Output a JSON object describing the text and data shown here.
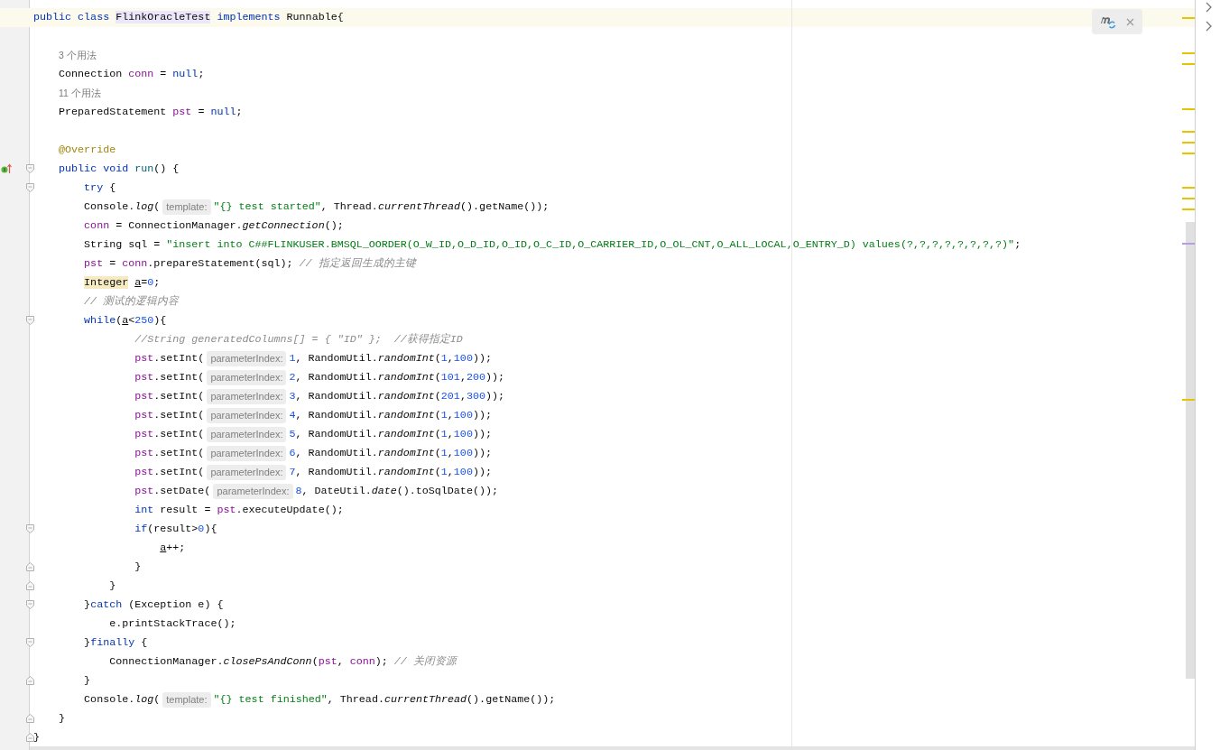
{
  "editor": {
    "lines": [
      {
        "kind": "code",
        "current": true,
        "tokens": [
          {
            "kind": "kw",
            "text": "public class "
          },
          {
            "kind": "decl",
            "text": "FlinkOracleTest"
          },
          {
            "kind": "kw",
            "text": " implements "
          },
          {
            "kind": "plain",
            "text": "Runnable{"
          }
        ]
      },
      {
        "kind": "blank",
        "current": false
      },
      {
        "kind": "usage",
        "current": false,
        "text": "    3 个用法"
      },
      {
        "kind": "code",
        "current": false,
        "tokens": [
          {
            "kind": "plain",
            "text": "    Connection "
          },
          {
            "kind": "field",
            "text": "conn"
          },
          {
            "kind": "plain",
            "text": " = "
          },
          {
            "kind": "kw",
            "text": "null"
          },
          {
            "kind": "plain",
            "text": ";"
          }
        ]
      },
      {
        "kind": "usage",
        "current": false,
        "text": "    11 个用法"
      },
      {
        "kind": "code",
        "current": false,
        "tokens": [
          {
            "kind": "plain",
            "text": "    PreparedStatement "
          },
          {
            "kind": "field",
            "text": "pst"
          },
          {
            "kind": "plain",
            "text": " = "
          },
          {
            "kind": "kw",
            "text": "null"
          },
          {
            "kind": "plain",
            "text": ";"
          }
        ]
      },
      {
        "kind": "blank",
        "current": false
      },
      {
        "kind": "code",
        "current": false,
        "tokens": [
          {
            "kind": "annotation",
            "text": "    @Override"
          }
        ]
      },
      {
        "kind": "code",
        "current": false,
        "fold_start": true,
        "override_marker": true,
        "tokens": [
          {
            "kind": "kw",
            "text": "    public void "
          },
          {
            "kind": "method",
            "text": "run"
          },
          {
            "kind": "plain",
            "text": "() {"
          }
        ]
      },
      {
        "kind": "code",
        "current": false,
        "fold_start": true,
        "tokens": [
          {
            "kind": "kw",
            "text": "        try"
          },
          {
            "kind": "plain",
            "text": " {"
          }
        ]
      },
      {
        "kind": "code",
        "current": false,
        "tokens": [
          {
            "kind": "plain",
            "text": "        Console."
          },
          {
            "kind": "static",
            "text": "log"
          },
          {
            "kind": "plain",
            "text": "("
          },
          {
            "kind": "hint",
            "text": "template:"
          },
          {
            "kind": "str",
            "text": "\"{} test started\""
          },
          {
            "kind": "plain",
            "text": ", Thread."
          },
          {
            "kind": "static",
            "text": "currentThread"
          },
          {
            "kind": "plain",
            "text": "().getName());"
          }
        ]
      },
      {
        "kind": "code",
        "current": false,
        "tokens": [
          {
            "kind": "field",
            "text": "        conn"
          },
          {
            "kind": "plain",
            "text": " = ConnectionManager."
          },
          {
            "kind": "static",
            "text": "getConnection"
          },
          {
            "kind": "plain",
            "text": "();"
          }
        ]
      },
      {
        "kind": "code",
        "current": false,
        "tokens": [
          {
            "kind": "plain",
            "text": "        String sql = "
          },
          {
            "kind": "str",
            "text": "\"insert into C##FLINKUSER.BMSQL_OORDER(O_W_ID,O_D_ID,O_ID,O_C_ID,O_CARRIER_ID,O_OL_CNT,O_ALL_LOCAL,O_ENTRY_D) values(?,?,?,?,?,?,?,?)\""
          },
          {
            "kind": "plain",
            "text": ";"
          }
        ]
      },
      {
        "kind": "code",
        "current": false,
        "tokens": [
          {
            "kind": "field",
            "text": "        pst"
          },
          {
            "kind": "plain",
            "text": " = "
          },
          {
            "kind": "field",
            "text": "conn"
          },
          {
            "kind": "plain",
            "text": ".prepareStatement(sql); "
          },
          {
            "kind": "comment",
            "text": "// 指定返回生成的主键"
          }
        ]
      },
      {
        "kind": "code",
        "current": false,
        "tokens": [
          {
            "kind": "usagehl",
            "text": "        Integer"
          },
          {
            "kind": "underline",
            "text": " a"
          },
          {
            "kind": "plain",
            "text": "="
          },
          {
            "kind": "num",
            "text": "0"
          },
          {
            "kind": "plain",
            "text": ";"
          }
        ]
      },
      {
        "kind": "code",
        "current": false,
        "tokens": [
          {
            "kind": "comment",
            "text": "        // 测试的逻辑内容"
          }
        ]
      },
      {
        "kind": "code",
        "current": false,
        "fold_start": true,
        "tokens": [
          {
            "kind": "kw",
            "text": "        while"
          },
          {
            "kind": "plain",
            "text": "("
          },
          {
            "kind": "underline",
            "text": "a"
          },
          {
            "kind": "plain",
            "text": "<"
          },
          {
            "kind": "num",
            "text": "250"
          },
          {
            "kind": "plain",
            "text": "){"
          }
        ]
      },
      {
        "kind": "code",
        "current": false,
        "tokens": [
          {
            "kind": "comment",
            "text": "                //String generatedColumns[] = { \"ID\" };  //获得指定ID"
          }
        ]
      },
      {
        "kind": "code",
        "current": false,
        "tokens": [
          {
            "kind": "field",
            "text": "                pst"
          },
          {
            "kind": "plain",
            "text": ".setInt("
          },
          {
            "kind": "hint",
            "text": "parameterIndex:"
          },
          {
            "kind": "num",
            "text": "1"
          },
          {
            "kind": "plain",
            "text": ", RandomUtil."
          },
          {
            "kind": "static",
            "text": "randomInt"
          },
          {
            "kind": "plain",
            "text": "("
          },
          {
            "kind": "num",
            "text": "1"
          },
          {
            "kind": "plain",
            "text": ","
          },
          {
            "kind": "num",
            "text": "100"
          },
          {
            "kind": "plain",
            "text": "));"
          }
        ]
      },
      {
        "kind": "code",
        "current": false,
        "tokens": [
          {
            "kind": "field",
            "text": "                pst"
          },
          {
            "kind": "plain",
            "text": ".setInt("
          },
          {
            "kind": "hint",
            "text": "parameterIndex:"
          },
          {
            "kind": "num",
            "text": "2"
          },
          {
            "kind": "plain",
            "text": ", RandomUtil."
          },
          {
            "kind": "static",
            "text": "randomInt"
          },
          {
            "kind": "plain",
            "text": "("
          },
          {
            "kind": "num",
            "text": "101"
          },
          {
            "kind": "plain",
            "text": ","
          },
          {
            "kind": "num",
            "text": "200"
          },
          {
            "kind": "plain",
            "text": "));"
          }
        ]
      },
      {
        "kind": "code",
        "current": false,
        "tokens": [
          {
            "kind": "field",
            "text": "                pst"
          },
          {
            "kind": "plain",
            "text": ".setInt("
          },
          {
            "kind": "hint",
            "text": "parameterIndex:"
          },
          {
            "kind": "num",
            "text": "3"
          },
          {
            "kind": "plain",
            "text": ", RandomUtil."
          },
          {
            "kind": "static",
            "text": "randomInt"
          },
          {
            "kind": "plain",
            "text": "("
          },
          {
            "kind": "num",
            "text": "201"
          },
          {
            "kind": "plain",
            "text": ","
          },
          {
            "kind": "num",
            "text": "300"
          },
          {
            "kind": "plain",
            "text": "));"
          }
        ]
      },
      {
        "kind": "code",
        "current": false,
        "tokens": [
          {
            "kind": "field",
            "text": "                pst"
          },
          {
            "kind": "plain",
            "text": ".setInt("
          },
          {
            "kind": "hint",
            "text": "parameterIndex:"
          },
          {
            "kind": "num",
            "text": "4"
          },
          {
            "kind": "plain",
            "text": ", RandomUtil."
          },
          {
            "kind": "static",
            "text": "randomInt"
          },
          {
            "kind": "plain",
            "text": "("
          },
          {
            "kind": "num",
            "text": "1"
          },
          {
            "kind": "plain",
            "text": ","
          },
          {
            "kind": "num",
            "text": "100"
          },
          {
            "kind": "plain",
            "text": "));"
          }
        ]
      },
      {
        "kind": "code",
        "current": false,
        "tokens": [
          {
            "kind": "field",
            "text": "                pst"
          },
          {
            "kind": "plain",
            "text": ".setInt("
          },
          {
            "kind": "hint",
            "text": "parameterIndex:"
          },
          {
            "kind": "num",
            "text": "5"
          },
          {
            "kind": "plain",
            "text": ", RandomUtil."
          },
          {
            "kind": "static",
            "text": "randomInt"
          },
          {
            "kind": "plain",
            "text": "("
          },
          {
            "kind": "num",
            "text": "1"
          },
          {
            "kind": "plain",
            "text": ","
          },
          {
            "kind": "num",
            "text": "100"
          },
          {
            "kind": "plain",
            "text": "));"
          }
        ]
      },
      {
        "kind": "code",
        "current": false,
        "tokens": [
          {
            "kind": "field",
            "text": "                pst"
          },
          {
            "kind": "plain",
            "text": ".setInt("
          },
          {
            "kind": "hint",
            "text": "parameterIndex:"
          },
          {
            "kind": "num",
            "text": "6"
          },
          {
            "kind": "plain",
            "text": ", RandomUtil."
          },
          {
            "kind": "static",
            "text": "randomInt"
          },
          {
            "kind": "plain",
            "text": "("
          },
          {
            "kind": "num",
            "text": "1"
          },
          {
            "kind": "plain",
            "text": ","
          },
          {
            "kind": "num",
            "text": "100"
          },
          {
            "kind": "plain",
            "text": "));"
          }
        ]
      },
      {
        "kind": "code",
        "current": false,
        "tokens": [
          {
            "kind": "field",
            "text": "                pst"
          },
          {
            "kind": "plain",
            "text": ".setInt("
          },
          {
            "kind": "hint",
            "text": "parameterIndex:"
          },
          {
            "kind": "num",
            "text": "7"
          },
          {
            "kind": "plain",
            "text": ", RandomUtil."
          },
          {
            "kind": "static",
            "text": "randomInt"
          },
          {
            "kind": "plain",
            "text": "("
          },
          {
            "kind": "num",
            "text": "1"
          },
          {
            "kind": "plain",
            "text": ","
          },
          {
            "kind": "num",
            "text": "100"
          },
          {
            "kind": "plain",
            "text": "));"
          }
        ]
      },
      {
        "kind": "code",
        "current": false,
        "tokens": [
          {
            "kind": "field",
            "text": "                pst"
          },
          {
            "kind": "plain",
            "text": ".setDate("
          },
          {
            "kind": "hint",
            "text": "parameterIndex:"
          },
          {
            "kind": "num",
            "text": "8"
          },
          {
            "kind": "plain",
            "text": ", DateUtil."
          },
          {
            "kind": "static",
            "text": "date"
          },
          {
            "kind": "plain",
            "text": "().toSqlDate());"
          }
        ]
      },
      {
        "kind": "code",
        "current": false,
        "tokens": [
          {
            "kind": "kw",
            "text": "                int"
          },
          {
            "kind": "plain",
            "text": " result = "
          },
          {
            "kind": "field",
            "text": "pst"
          },
          {
            "kind": "plain",
            "text": ".executeUpdate();"
          }
        ]
      },
      {
        "kind": "code",
        "current": false,
        "fold_start": true,
        "tokens": [
          {
            "kind": "kw",
            "text": "                if"
          },
          {
            "kind": "plain",
            "text": "(result>"
          },
          {
            "kind": "num",
            "text": "0"
          },
          {
            "kind": "plain",
            "text": "){"
          }
        ]
      },
      {
        "kind": "code",
        "current": false,
        "tokens": [
          {
            "kind": "underline",
            "text": "                    a"
          },
          {
            "kind": "plain",
            "text": "++;"
          }
        ]
      },
      {
        "kind": "code",
        "current": false,
        "fold_end": true,
        "tokens": [
          {
            "kind": "plain",
            "text": "                }"
          }
        ]
      },
      {
        "kind": "code",
        "current": false,
        "fold_end": true,
        "tokens": [
          {
            "kind": "plain",
            "text": "            }"
          }
        ]
      },
      {
        "kind": "code",
        "current": false,
        "fold_start": true,
        "tokens": [
          {
            "kind": "plain",
            "text": "        }"
          },
          {
            "kind": "kw",
            "text": "catch"
          },
          {
            "kind": "plain",
            "text": " (Exception e) {"
          }
        ]
      },
      {
        "kind": "code",
        "current": false,
        "tokens": [
          {
            "kind": "plain",
            "text": "            e.printStackTrace();"
          }
        ]
      },
      {
        "kind": "code",
        "current": false,
        "fold_start": true,
        "tokens": [
          {
            "kind": "plain",
            "text": "        }"
          },
          {
            "kind": "kw",
            "text": "finally"
          },
          {
            "kind": "plain",
            "text": " {"
          }
        ]
      },
      {
        "kind": "code",
        "current": false,
        "tokens": [
          {
            "kind": "plain",
            "text": "            ConnectionManager."
          },
          {
            "kind": "static",
            "text": "closePsAndConn"
          },
          {
            "kind": "plain",
            "text": "("
          },
          {
            "kind": "field",
            "text": "pst"
          },
          {
            "kind": "plain",
            "text": ", "
          },
          {
            "kind": "field",
            "text": "conn"
          },
          {
            "kind": "plain",
            "text": "); "
          },
          {
            "kind": "comment",
            "text": "// 关闭资源"
          }
        ]
      },
      {
        "kind": "code",
        "current": false,
        "fold_end": true,
        "tokens": [
          {
            "kind": "plain",
            "text": "        }"
          }
        ]
      },
      {
        "kind": "code",
        "current": false,
        "tokens": [
          {
            "kind": "plain",
            "text": "        Console."
          },
          {
            "kind": "static",
            "text": "log"
          },
          {
            "kind": "plain",
            "text": "("
          },
          {
            "kind": "hint",
            "text": "template:"
          },
          {
            "kind": "str",
            "text": "\"{} test finished\""
          },
          {
            "kind": "plain",
            "text": ", Thread."
          },
          {
            "kind": "static",
            "text": "currentThread"
          },
          {
            "kind": "plain",
            "text": "().getName());"
          }
        ]
      },
      {
        "kind": "code",
        "current": false,
        "fold_end": true,
        "tokens": [
          {
            "kind": "plain",
            "text": "    }"
          }
        ]
      },
      {
        "kind": "code",
        "current": false,
        "fold_end": true,
        "tokens": [
          {
            "kind": "plain",
            "text": "}"
          }
        ]
      }
    ]
  }
}
